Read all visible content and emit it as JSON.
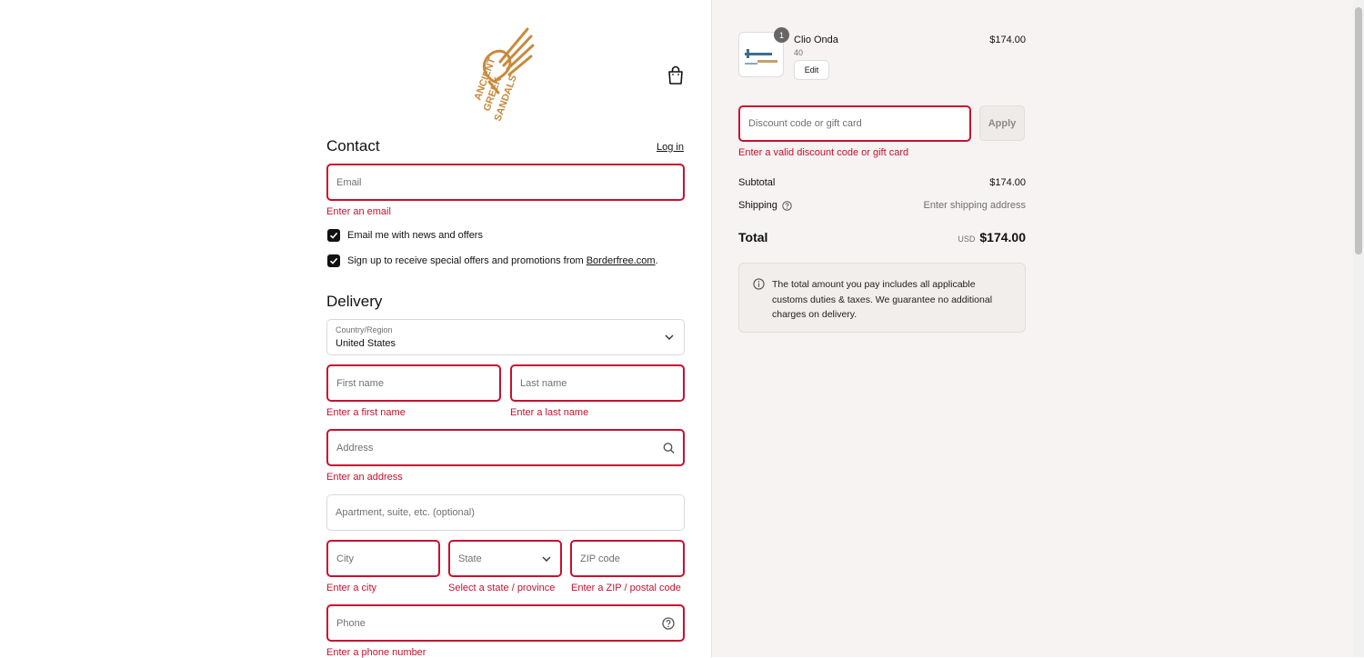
{
  "brand": {
    "logo_lines": [
      "ANCIENT",
      "GREEK",
      "SANDALS"
    ],
    "logo_color": "#c88a3c"
  },
  "header": {
    "cart_icon": "shopping-bag-icon"
  },
  "contact": {
    "title": "Contact",
    "login_label": "Log in",
    "email_placeholder": "Email",
    "email_error": "Enter an email",
    "news_checkbox_label": "Email me with news and offers",
    "promo_checkbox_prefix": "Sign up to receive special offers and promotions from ",
    "promo_link": "Borderfree.com",
    "promo_suffix": "."
  },
  "delivery": {
    "title": "Delivery",
    "country_label": "Country/Region",
    "country_value": "United States",
    "first_name_placeholder": "First name",
    "first_name_error": "Enter a first name",
    "last_name_placeholder": "Last name",
    "last_name_error": "Enter a last name",
    "address_placeholder": "Address",
    "address_error": "Enter an address",
    "apartment_placeholder": "Apartment, suite, etc. (optional)",
    "city_placeholder": "City",
    "city_error": "Enter a city",
    "state_value": "State",
    "state_error": "Select a state / province",
    "zip_placeholder": "ZIP code",
    "zip_error": "Enter a ZIP / postal code",
    "phone_placeholder": "Phone",
    "phone_error": "Enter a phone number"
  },
  "summary": {
    "item": {
      "quantity": "1",
      "name": "Clio Onda",
      "variant": "40",
      "edit_label": "Edit",
      "price": "$174.00"
    },
    "discount_placeholder": "Discount code or gift card",
    "apply_label": "Apply",
    "discount_error": "Enter a valid discount code or gift card",
    "subtotal_label": "Subtotal",
    "subtotal_value": "$174.00",
    "shipping_label": "Shipping",
    "shipping_value": "Enter shipping address",
    "total_label": "Total",
    "total_currency": "USD",
    "total_value": "$174.00",
    "duties_notice": "The total amount you pay includes all applicable customs duties & taxes. We guarantee no additional charges on delivery."
  },
  "colors": {
    "error": "#c8102e",
    "summary_background": "#f6f3f2"
  }
}
